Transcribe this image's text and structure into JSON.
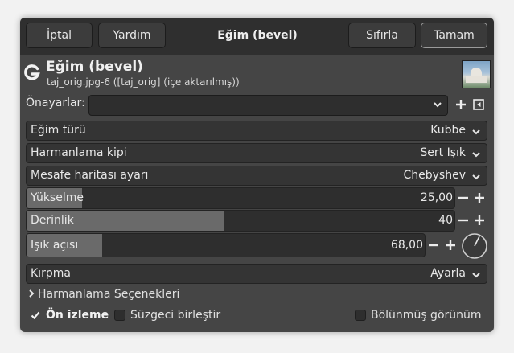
{
  "header": {
    "cancel_label": "İptal",
    "help_label": "Yardım",
    "title": "Eğim (bevel)",
    "reset_label": "Sıfırla",
    "ok_label": "Tamam"
  },
  "operation": {
    "logo_icon": "gegl-icon",
    "title": "Eğim (bevel)",
    "subtitle": "taj_orig.jpg-6 ([taj_orig] (içe aktarılmış))",
    "thumbnail_icon": "image-thumbnail-icon"
  },
  "presets": {
    "label": "Önayarlar:",
    "value": ""
  },
  "fields": {
    "bevel_type": {
      "label": "Eğim türü",
      "value": "Kubbe"
    },
    "blend_mode": {
      "label": "Harmanlama kipi",
      "value": "Sert Işık"
    },
    "distance_map": {
      "label": "Mesafe haritası ayarı",
      "value": "Chebyshev"
    },
    "elevation": {
      "label": "Yükselme",
      "value": "25,00",
      "fill_fraction": 0.13
    },
    "depth": {
      "label": "Derinlik",
      "value": "40",
      "fill_fraction": 0.46
    },
    "light_angle": {
      "label": "Işık açısı",
      "value": "68,00",
      "fill_fraction": 0.19
    },
    "clipping": {
      "label": "Kırpma",
      "value": "Ayarla"
    }
  },
  "blending_options": {
    "label": "Harmanlama Seçenekleri"
  },
  "footer": {
    "preview": {
      "label": "Ön izleme",
      "checked": true
    },
    "merge_filter": {
      "label": "Süzgeci birleştir",
      "checked": false
    },
    "split_view": {
      "label": "Bölünmüş görünüm",
      "checked": false
    }
  },
  "colors": {
    "dialog_bg": "#454545",
    "headerbar_bg": "#2f2f2f",
    "field_bg": "#343434",
    "slider_fill": "#6a6a6a"
  }
}
